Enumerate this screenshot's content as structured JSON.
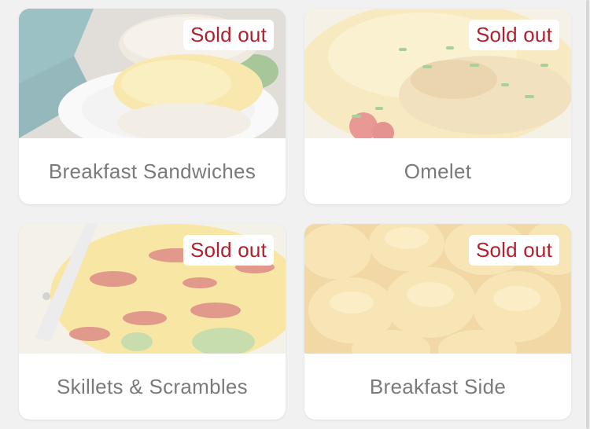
{
  "menu_categories": [
    {
      "name": "Breakfast Sandwiches",
      "badge": "Sold out"
    },
    {
      "name": "Omelet",
      "badge": "Sold out"
    },
    {
      "name": "Skillets & Scrambles",
      "badge": "Sold out"
    },
    {
      "name": "Breakfast Side",
      "badge": "Sold out"
    }
  ],
  "colors": {
    "badge_text": "#b3202c",
    "label_text": "#7a7a7a",
    "background": "#f1f1f1"
  }
}
